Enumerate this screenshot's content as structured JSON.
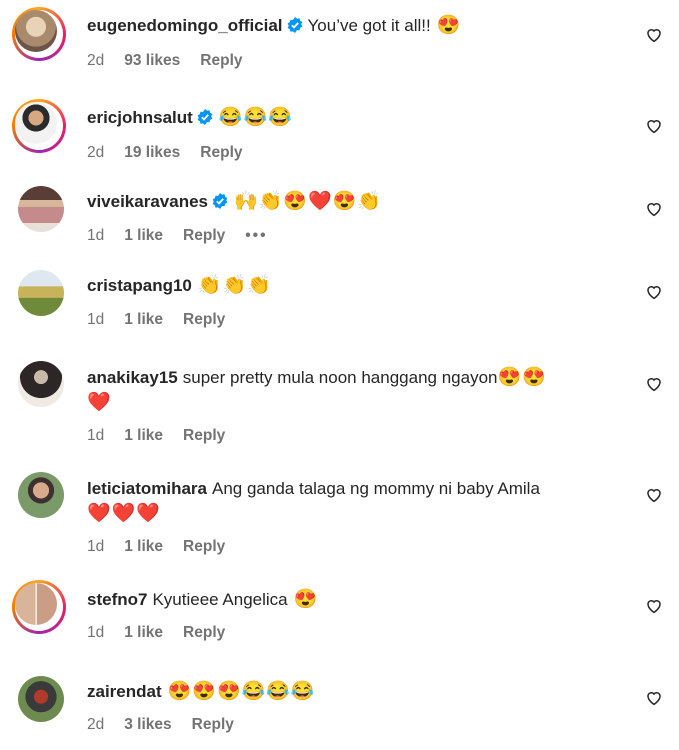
{
  "comments": [
    {
      "username": "eugenedomingo_official",
      "verified": true,
      "text": "You’ve got it all!!",
      "emojis": "😍",
      "time": "2d",
      "likes": "93 likes",
      "reply": "Reply",
      "story": true
    },
    {
      "username": "ericjohnsalut",
      "verified": true,
      "text": "",
      "emojis": "😂😂😂",
      "time": "2d",
      "likes": "19 likes",
      "reply": "Reply",
      "story": true
    },
    {
      "username": "viveikaravanes",
      "verified": true,
      "text": "",
      "emojis": "🙌👏😍❤️😍👏",
      "time": "1d",
      "likes": "1 like",
      "reply": "Reply",
      "more": "•••",
      "story": false
    },
    {
      "username": "cristapang10",
      "verified": false,
      "text": "",
      "emojis": "👏👏👏",
      "time": "1d",
      "likes": "1 like",
      "reply": "Reply",
      "story": false
    },
    {
      "username": "anakikay15",
      "verified": false,
      "text": "super pretty mula noon hanggang ngayon",
      "emojis": "😍😍",
      "emojis2": "❤️",
      "time": "1d",
      "likes": "1 like",
      "reply": "Reply",
      "story": false
    },
    {
      "username": "leticiatomihara",
      "verified": false,
      "text": "Ang ganda talaga ng mommy ni baby Amila",
      "emojis": "",
      "emojis2": "❤️❤️❤️",
      "time": "1d",
      "likes": "1 like",
      "reply": "Reply",
      "story": false
    },
    {
      "username": "stefno7",
      "verified": false,
      "text": "Kyutieee Angelica",
      "emojis": "😍",
      "time": "1d",
      "likes": "1 like",
      "reply": "Reply",
      "story": true
    },
    {
      "username": "zairendat",
      "verified": false,
      "text": "",
      "emojis": "😍😍😍😂😂😂",
      "time": "2d",
      "likes": "3 likes",
      "reply": "Reply",
      "story": false
    }
  ],
  "colors": {
    "verified": "#0095f6",
    "text": "#262626",
    "muted": "#737373",
    "heart_emoji": "#e0245e"
  }
}
